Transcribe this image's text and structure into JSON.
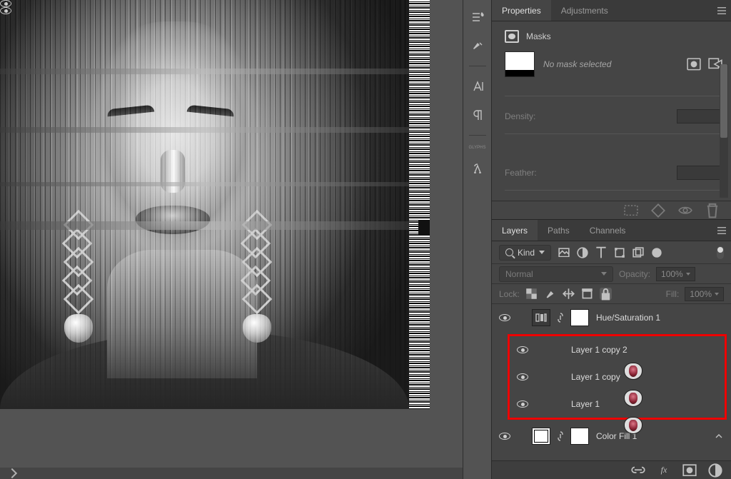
{
  "panels": {
    "properties": {
      "tab_properties": "Properties",
      "tab_adjustments": "Adjustments",
      "section_label": "Masks",
      "no_mask_text": "No mask selected",
      "density_label": "Density:",
      "feather_label": "Feather:"
    },
    "layers": {
      "tab_layers": "Layers",
      "tab_paths": "Paths",
      "tab_channels": "Channels",
      "kind_label": "Kind",
      "blend_mode": "Normal",
      "opacity_label": "Opacity:",
      "opacity_value": "100%",
      "lock_label": "Lock:",
      "fill_label": "Fill:",
      "fill_value": "100%",
      "items": [
        {
          "name": "Hue/Saturation 1",
          "type": "adjustment"
        },
        {
          "name": "Layer 1 copy 2",
          "type": "raster"
        },
        {
          "name": "Layer 1 copy",
          "type": "raster"
        },
        {
          "name": "Layer 1",
          "type": "raster"
        },
        {
          "name": "Color Fill 1",
          "type": "fill"
        }
      ]
    }
  }
}
